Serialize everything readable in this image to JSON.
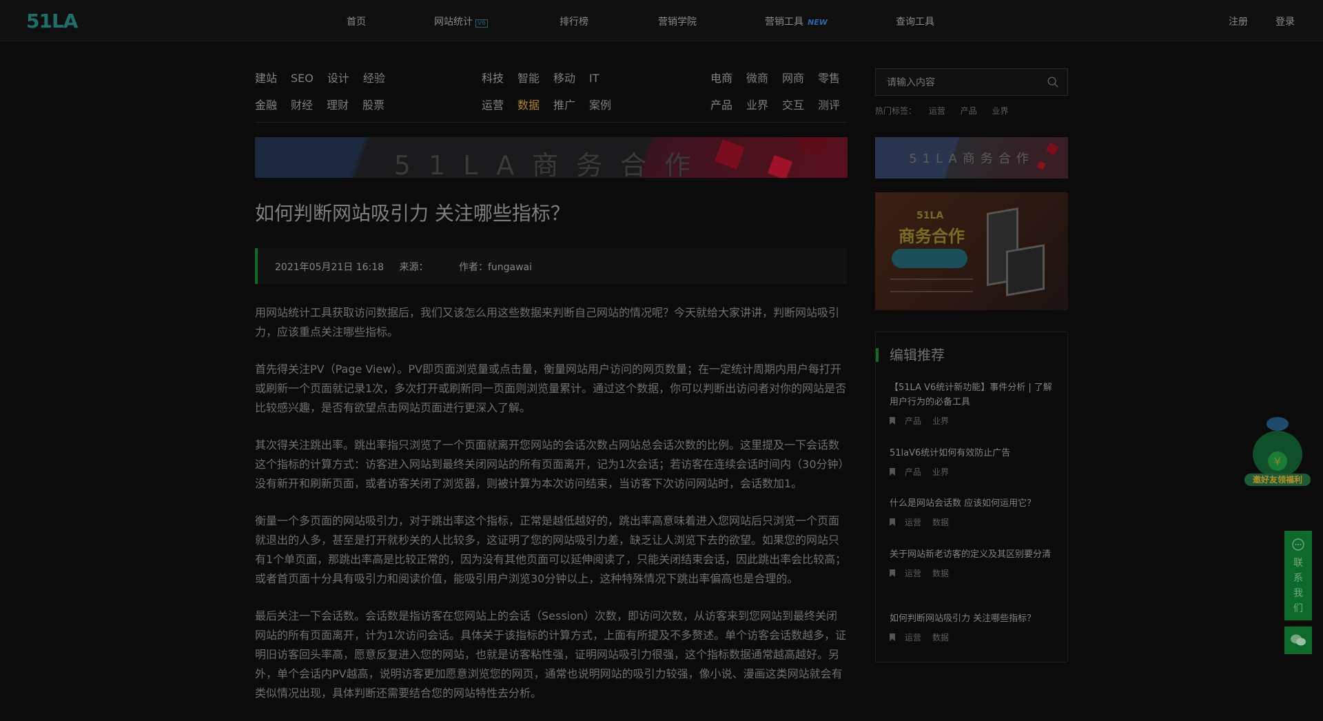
{
  "brand": {
    "logo_text": "51LA"
  },
  "nav": {
    "items": [
      {
        "label": "首页"
      },
      {
        "label": "网站统计",
        "badge": "V6"
      },
      {
        "label": "排行榜"
      },
      {
        "label": "营销学院"
      },
      {
        "label": "营销工具",
        "badge": "NEW"
      },
      {
        "label": "查询工具"
      }
    ],
    "register": "注册",
    "login": "登录"
  },
  "categories": [
    {
      "rows": [
        [
          "建站",
          "SEO",
          "设计",
          "经验"
        ],
        [
          "金融",
          "财经",
          "理财",
          "股票"
        ]
      ]
    },
    {
      "rows": [
        [
          "科技",
          "智能",
          "移动",
          "IT"
        ],
        [
          "运营",
          "数据",
          "推广",
          "案例"
        ]
      ]
    },
    {
      "rows": [
        [
          "电商",
          "微商",
          "网商",
          "零售"
        ],
        [
          "产品",
          "业界",
          "交互",
          "测评"
        ]
      ]
    }
  ],
  "active_category": "数据",
  "banner": {
    "text": "51LA商务合作"
  },
  "article": {
    "title": "如何判断网站吸引力 关注哪些指标？",
    "date": "2021年05月21日 16:18",
    "source_label": "来源：",
    "author_label": "作者：fungawai",
    "paragraphs": [
      "用网站统计工具获取访问数据后，我们又该怎么用这些数据来判断自己网站的情况呢？今天就给大家讲讲，判断网站吸引力，应该重点关注哪些指标。",
      "首先得关注PV（Page View）。PV即页面浏览量或点击量，衡量网站用户访问的网页数量；在一定统计周期内用户每打开或刷新一个页面就记录1次，多次打开或刷新同一页面则浏览量累计。通过这个数据，你可以判断出访问者对你的网站是否比较感兴趣，是否有欲望点击网站页面进行更深入了解。",
      "其次得关注跳出率。跳出率指只浏览了一个页面就离开您网站的会话次数占网站总会话次数的比例。这里提及一下会话数这个指标的计算方式：访客进入网站到最终关闭网站的所有页面离开，记为1次会话；若访客在连续会话时间内（30分钟）没有新开和刷新页面，或者访客关闭了浏览器，则被计算为本次访问结束，当访客下次访问网站时，会话数加1。",
      "衡量一个多页面的网站吸引力，对于跳出率这个指标，正常是越低越好的，跳出率高意味着进入您网站后只浏览一个页面就退出的人多，甚至是打开就秒关的人比较多，这证明了您的网站吸引力差，缺乏让人浏览下去的欲望。如果您的网站只有1个单页面，那跳出率高是比较正常的，因为没有其他页面可以延伸阅读了，只能关闭结束会话，因此跳出率会比较高；或者首页面十分具有吸引力和阅读价值，能吸引用户浏览30分钟以上，这种特殊情况下跳出率偏高也是合理的。",
      "最后关注一下会话数。会话数是指访客在您网站上的会话（Session）次数，即访问次数，从访客来到您网站到最终关闭网站的所有页面离开，计为1次访问会话。具体关于该指标的计算方式，上面有所提及不多赘述。单个访客会话数越多，证明旧访客回头率高，愿意反复进入您的网站，也就是访客粘性强，证明网站吸引力很强，这个指标数据通常越高越好。另外，单个会话内PV越高，说明访客更加愿意浏览您的网页，通常也说明网站的吸引力较强，像小说、漫画这类网站就会有类似情况出现，具体判断还需要结合您的网站特性去分析。"
    ]
  },
  "sidebar": {
    "search_placeholder": "请输入内容",
    "hot_label": "热门标签：",
    "hot_tags": [
      "运营",
      "产品",
      "业界"
    ],
    "banner_text": "51LA商务合作",
    "promo": {
      "brand": "51LA",
      "title": "商务合作"
    },
    "recommend_title": "编辑推荐",
    "recommend": [
      {
        "title": "【51LA V6统计新功能】事件分析 | 了解用户行为的必备工具",
        "tags": [
          "产品",
          "业界"
        ]
      },
      {
        "title": "51laV6统计如何有效防止广告",
        "tags": [
          "产品",
          "业界"
        ]
      },
      {
        "title": "什么是网站会话数 应该如何运用它？",
        "tags": [
          "运营",
          "数据"
        ]
      },
      {
        "title": "关于网站新老访客的定义及其区别要分清",
        "tags": [
          "运营",
          "数据"
        ]
      },
      {
        "title": "如何判断网站吸引力 关注哪些指标？",
        "tags": [
          "运营",
          "数据"
        ]
      }
    ]
  },
  "floating": {
    "mascot_text": "邀好友领福利",
    "contact_text": "联系我们"
  },
  "colors": {
    "accent_green": "#0e6a26",
    "active_category": "#b0822a",
    "background": "#0b0b0b"
  }
}
